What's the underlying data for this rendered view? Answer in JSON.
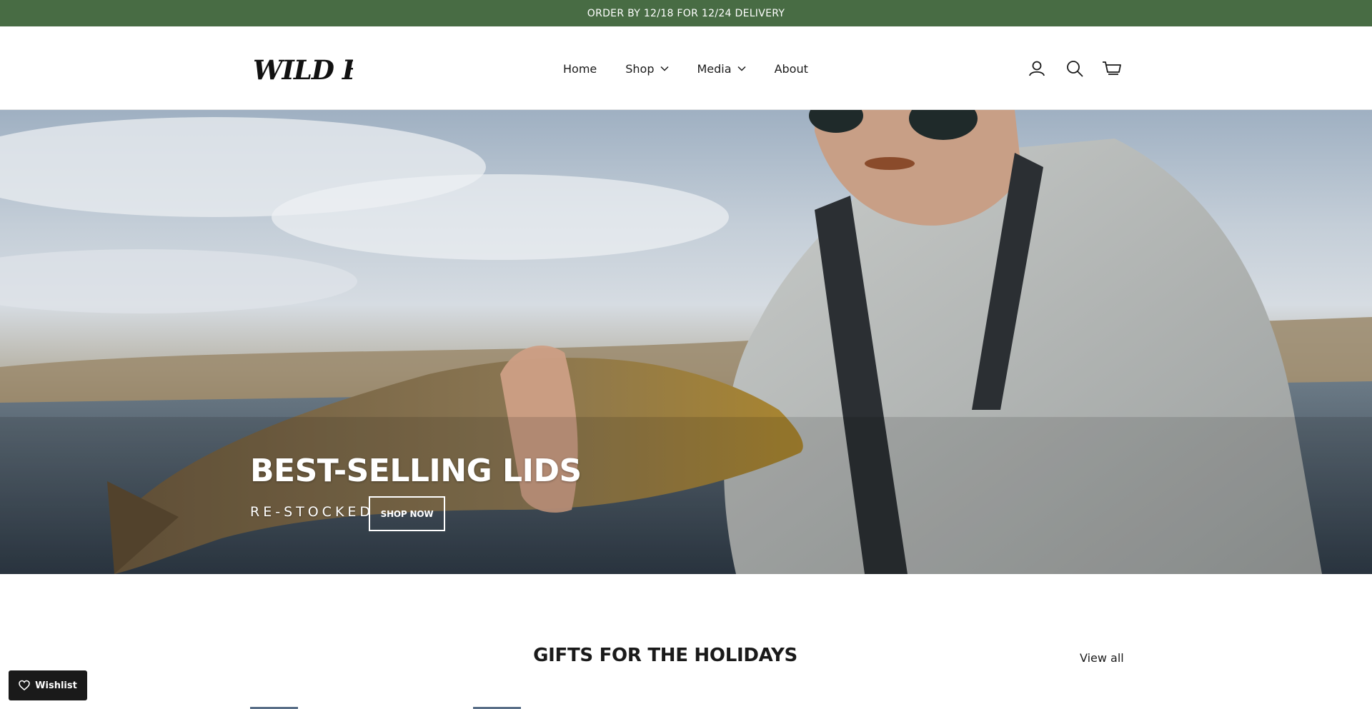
{
  "announcement": {
    "text": "ORDER BY 12/18 FOR 12/24 DELIVERY"
  },
  "header": {
    "logo_text": "WILD FLY",
    "nav": [
      {
        "label": "Home",
        "has_dropdown": false
      },
      {
        "label": "Shop",
        "has_dropdown": true
      },
      {
        "label": "Media",
        "has_dropdown": true
      },
      {
        "label": "About",
        "has_dropdown": false
      }
    ],
    "icons": [
      "account-icon",
      "search-icon",
      "cart-icon"
    ]
  },
  "hero": {
    "title": "BEST-SELLING LIDS",
    "subtitle": "RE-STOCKED",
    "button_label": "SHOP NOW"
  },
  "featured": {
    "title": "GIFTS FOR THE HOLIDAYS",
    "view_all_label": "View all"
  },
  "wishlist": {
    "label": "Wishlist"
  },
  "colors": {
    "announcement_bg": "#486c44",
    "text": "#1a1a1a",
    "wishlist_bg": "#1a1a1a"
  }
}
